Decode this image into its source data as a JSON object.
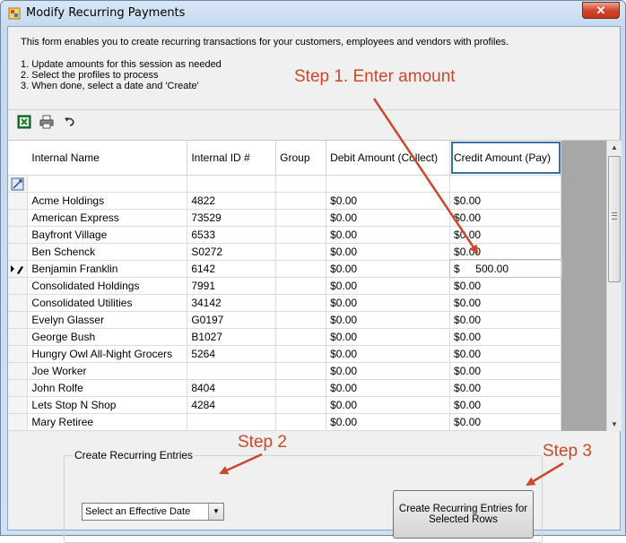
{
  "window": {
    "title": "Modify Recurring Payments",
    "close_label": "✕"
  },
  "intro": {
    "description": "This form enables you to create recurring transactions for your customers, employees and vendors with profiles.",
    "steps": [
      "1. Update amounts for this session as needed",
      "2. Select the profiles to process",
      "3. When done, select a date and 'Create'"
    ]
  },
  "toolbar": {
    "icons": [
      "excel-export-icon",
      "print-icon",
      "undo-icon"
    ]
  },
  "grid": {
    "columns": [
      "Internal Name",
      "Internal ID #",
      "Group",
      "Debit Amount (Collect)",
      "Credit Amount (Pay)"
    ],
    "rows": [
      {
        "name": "Acme Holdings",
        "id": "4822",
        "group": "",
        "debit": "$0.00",
        "credit": "$0.00"
      },
      {
        "name": "American Express",
        "id": "73529",
        "group": "",
        "debit": "$0.00",
        "credit": "$0.00"
      },
      {
        "name": "Bayfront Village",
        "id": "6533",
        "group": "",
        "debit": "$0.00",
        "credit": "$0.00"
      },
      {
        "name": "Ben Schenck",
        "id": "S0272",
        "group": "",
        "debit": "$0.00",
        "credit": "$0.00"
      },
      {
        "name": "Benjamin Franklin",
        "id": "6142",
        "group": "",
        "debit": "$0.00",
        "credit_currency": "$",
        "credit_value": "500.00",
        "editing": true
      },
      {
        "name": "Consolidated Holdings",
        "id": "7991",
        "group": "",
        "debit": "$0.00",
        "credit": "$0.00"
      },
      {
        "name": "Consolidated Utilities",
        "id": "34142",
        "group": "",
        "debit": "$0.00",
        "credit": "$0.00"
      },
      {
        "name": "Evelyn Glasser",
        "id": "G0197",
        "group": "",
        "debit": "$0.00",
        "credit": "$0.00"
      },
      {
        "name": "George Bush",
        "id": "B1027",
        "group": "",
        "debit": "$0.00",
        "credit": "$0.00"
      },
      {
        "name": "Hungry Owl All-Night Grocers",
        "id": "5264",
        "group": "",
        "debit": "$0.00",
        "credit": "$0.00"
      },
      {
        "name": "Joe Worker",
        "id": "",
        "group": "",
        "debit": "$0.00",
        "credit": "$0.00"
      },
      {
        "name": "John Rolfe",
        "id": "8404",
        "group": "",
        "debit": "$0.00",
        "credit": "$0.00"
      },
      {
        "name": "Lets Stop N Shop",
        "id": "4284",
        "group": "",
        "debit": "$0.00",
        "credit": "$0.00"
      },
      {
        "name": "Mary Retiree",
        "id": "",
        "group": "",
        "debit": "$0.00",
        "credit": "$0.00"
      }
    ]
  },
  "recurring": {
    "group_label": "Create Recurring Entries",
    "date_select_value": "Select an Effective Date",
    "create_button_label": "Create Recurring Entries for Selected Rows"
  },
  "annotations": {
    "step1": "Step 1.  Enter amount",
    "step2": "Step 2",
    "step3": "Step 3"
  },
  "colors": {
    "annotation": "#c8492b",
    "title_gradient": "#c5d9ef",
    "close_button": "#d2472b"
  }
}
